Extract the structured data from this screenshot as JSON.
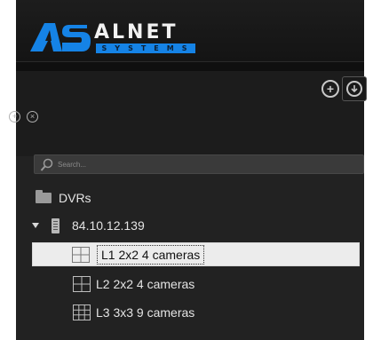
{
  "header": {
    "logo_letters": "AS",
    "logo_word": "ALNET",
    "logo_sub": "SYSTEMS"
  },
  "toolbar": {
    "add_icon": "plus-circle-icon",
    "download_icon": "download-circle-icon",
    "small_add_icon": "plus-circle-icon",
    "small_close_icon": "close-circle-icon"
  },
  "search": {
    "placeholder": "Search..."
  },
  "tree": {
    "group_label": "DVRs",
    "device_label": "84.10.12.139",
    "layouts": [
      {
        "label": "L1 2x2 4 cameras",
        "grid": "2x2",
        "selected": true
      },
      {
        "label": "L2 2x2 4 cameras",
        "grid": "2x2",
        "selected": false
      },
      {
        "label": "L3 3x3 9 cameras",
        "grid": "3x3",
        "selected": false
      }
    ]
  },
  "colors": {
    "header_bg": "#1a1a1a",
    "panel_bg": "#222222",
    "brand_blue": "#1583e6",
    "selection_bg": "#ececec"
  }
}
